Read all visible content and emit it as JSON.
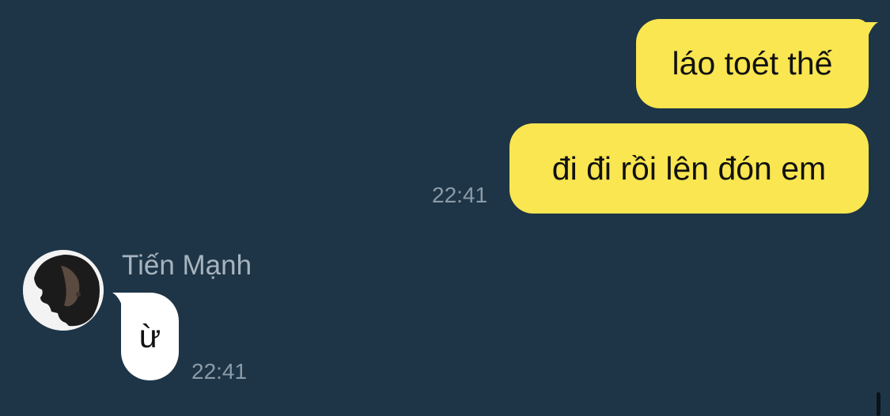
{
  "colors": {
    "background": "#1e3547",
    "outgoing_bubble": "#f9e650",
    "incoming_bubble": "#ffffff",
    "timestamp": "#8a9ba8",
    "sender_name": "#a7b4be"
  },
  "messages": {
    "outgoing": [
      {
        "text": "láo toét thế"
      },
      {
        "text": "đi đi rồi lên đón em",
        "time": "22:41"
      }
    ],
    "incoming": [
      {
        "sender": "Tiến Mạnh",
        "avatar_icon": "contact-avatar-icon",
        "text": "ừ",
        "time": "22:41"
      }
    ]
  }
}
